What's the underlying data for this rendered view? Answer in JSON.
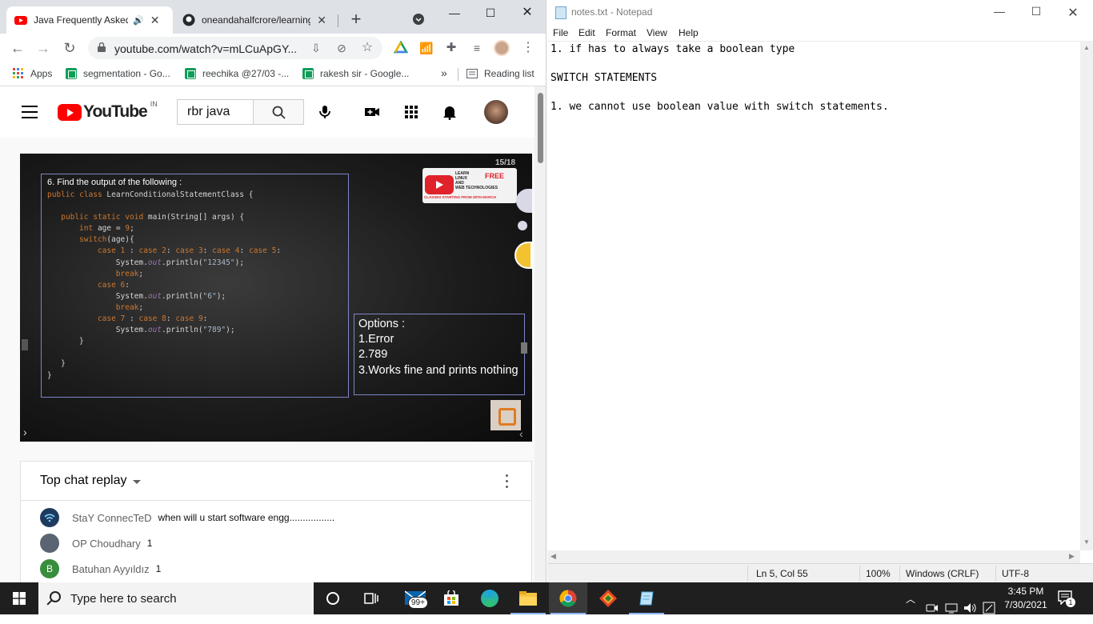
{
  "chrome": {
    "tabs": [
      {
        "title": "Java Frequently Asked",
        "active": true
      },
      {
        "title": "oneandahalfcrore/learning",
        "active": false
      }
    ],
    "url": "youtube.com/watch?v=mLCuApGY...",
    "bookmarks": [
      {
        "label": "Apps"
      },
      {
        "label": "segmentation - Go..."
      },
      {
        "label": "reechika @27/03 -..."
      },
      {
        "label": "rakesh sir - Google..."
      },
      {
        "label": "Reading list"
      }
    ],
    "bookmarks_overflow": "»"
  },
  "youtube": {
    "logo_word": "YouTube",
    "country_code": "IN",
    "search_value": "rbr java",
    "player": {
      "slide_number": "15/18",
      "question_title": "6. Find the output of the following :",
      "code_lines": [
        "public class LearnConditionalStatementClass {",
        "",
        "   public static void main(String[] args) {",
        "       int age = 9;",
        "       switch(age){",
        "           case 1 : case 2: case 3: case 4: case 5:",
        "               System.out.println(\"12345\");",
        "               break;",
        "           case 6:",
        "               System.out.println(\"6\");",
        "               break;",
        "           case 7 : case 8: case 9:",
        "               System.out.println(\"789\");",
        "       }",
        "",
        "   }",
        "}"
      ],
      "options_title": "Options :",
      "options": [
        "1.Error",
        "2.789",
        "3.Works fine and prints nothing"
      ],
      "promo": {
        "line1": "LEARN",
        "line2": "LINUX",
        "line3": "AND",
        "line4": "WEB TECHNOLOGIES",
        "free": "FREE",
        "bottom": "CLASSES STARTING FROM 28TH MARCH"
      }
    },
    "chat": {
      "title": "Top chat replay",
      "messages": [
        {
          "author": "StaY ConnecTeD",
          "text": "when will u start software engg.................",
          "avatar_color": "#1e3a5f"
        },
        {
          "author": "OP Choudhary",
          "text": "1",
          "avatar_color": "#5a6472"
        },
        {
          "author": "Batuhan Ayyıldız",
          "text": "1",
          "avatar_color": "#388e3c",
          "initial": "B"
        }
      ]
    }
  },
  "notepad": {
    "title": "notes.txt - Notepad",
    "menu": [
      "File",
      "Edit",
      "Format",
      "View",
      "Help"
    ],
    "lines": [
      "1. if has to always take a boolean type",
      "",
      "SWITCH STATEMENTS",
      "",
      "1. we cannot use boolean value with switch statements."
    ],
    "status": {
      "position": "Ln 5, Col 55",
      "zoom": "100%",
      "line_ending": "Windows (CRLF)",
      "encoding": "UTF-8"
    }
  },
  "taskbar": {
    "search_placeholder": "Type here to search",
    "mail_badge": "99+",
    "time": "3:45 PM",
    "date": "7/30/2021",
    "notification_count": "1"
  },
  "colors": {
    "youtube_red": "#ff0000",
    "taskbar_bg": "#1f1f1f",
    "chrome_tabstrip": "#dee1e6"
  }
}
